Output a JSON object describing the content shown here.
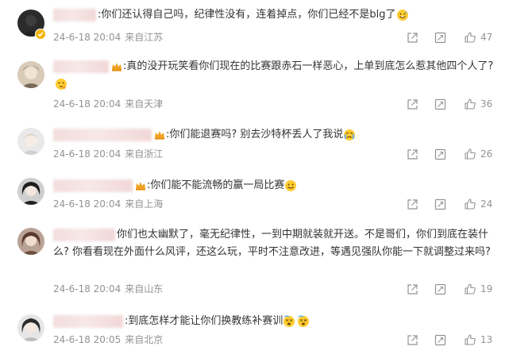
{
  "comments": [
    {
      "text_before": ":你们还认得自己吗，纪律性没有，连着掉点，你们已经不是blg了",
      "text_after": "",
      "timestamp": "24-6-18 20:04",
      "location": "来自江苏",
      "likes": "47",
      "emoji": "sweat-smile-emoji"
    },
    {
      "text_before": ":真的没开玩笑看你们现在的比赛跟赤石一样恶心，上单到底怎么惹其他四个人了?",
      "text_after": "",
      "timestamp": "24-6-18 20:04",
      "location": "来自天津",
      "likes": "36",
      "emoji": "thinking-emoji"
    },
    {
      "text_before": ":你们能退赛吗? 别去沙特杯丢人了我说",
      "text_after": "",
      "timestamp": "24-6-18 20:04",
      "location": "来自浙江",
      "likes": "26",
      "emoji": "crying-emoji"
    },
    {
      "text_before": ":你们能不能流畅的赢一局比赛",
      "text_after": "",
      "timestamp": "24-6-18 20:04",
      "location": "来自上海",
      "likes": "24",
      "emoji": "smile-emoji"
    },
    {
      "text_before": "你们也太幽默了，毫无纪律性，一到中期就装就开送。不是哥们，你们到底在装什么? 你看看现在外面什么风评，还这么玩，平时不注意改进，等遇见强队你能一下就调整过来吗?",
      "text_after": "",
      "timestamp": "24-6-18 20:04",
      "location": "来自山东",
      "likes": "19",
      "emoji": ""
    },
    {
      "text_before": ":到底怎样才能让你们换教练补赛训",
      "text_after": "",
      "timestamp": "24-6-18 20:05",
      "location": "来自北京",
      "likes": "13",
      "emoji": "dizzy-emoji"
    }
  ],
  "colors": {
    "text": "#333333",
    "meta": "#939393",
    "badge": "#f5b400",
    "crown": "#f0a020"
  },
  "icons": {
    "share": "share-icon",
    "reply": "reply-icon",
    "like": "thumbs-up-icon",
    "badge": "verified-badge-icon",
    "crown": "crown-icon"
  }
}
